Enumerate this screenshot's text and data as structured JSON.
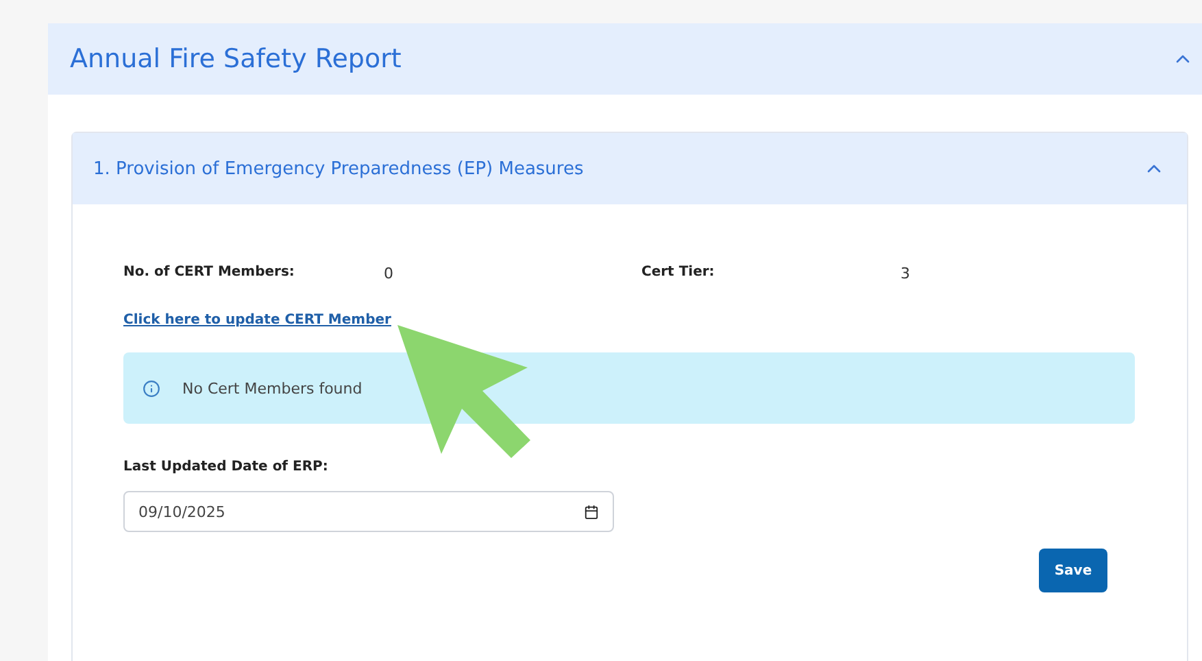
{
  "report": {
    "title": "Annual Fire Safety Report",
    "expanded": true,
    "section": {
      "title": "1. Provision of Emergency Preparedness (EP) Measures",
      "expanded": true,
      "fields": [
        {
          "label": "No. of CERT Members:",
          "value": "0"
        },
        {
          "label": "Cert Tier:",
          "value": "3"
        }
      ],
      "link": "Click here to update CERT Member",
      "alert": "No Cert Members found",
      "date_label": "Last Updated Date of ERP:",
      "date_value": "09/10/2025",
      "save": "Save"
    }
  }
}
